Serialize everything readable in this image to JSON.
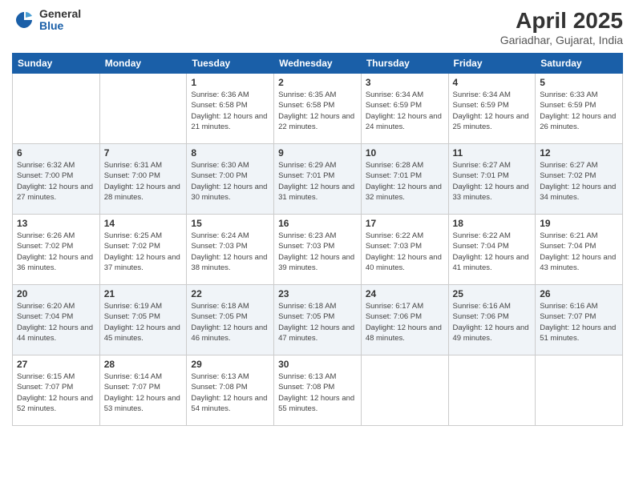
{
  "header": {
    "logo_general": "General",
    "logo_blue": "Blue",
    "month": "April 2025",
    "location": "Gariadhar, Gujarat, India"
  },
  "days_of_week": [
    "Sunday",
    "Monday",
    "Tuesday",
    "Wednesday",
    "Thursday",
    "Friday",
    "Saturday"
  ],
  "weeks": [
    [
      {
        "day": "",
        "sunrise": "",
        "sunset": "",
        "daylight": ""
      },
      {
        "day": "",
        "sunrise": "",
        "sunset": "",
        "daylight": ""
      },
      {
        "day": "1",
        "sunrise": "Sunrise: 6:36 AM",
        "sunset": "Sunset: 6:58 PM",
        "daylight": "Daylight: 12 hours and 21 minutes."
      },
      {
        "day": "2",
        "sunrise": "Sunrise: 6:35 AM",
        "sunset": "Sunset: 6:58 PM",
        "daylight": "Daylight: 12 hours and 22 minutes."
      },
      {
        "day": "3",
        "sunrise": "Sunrise: 6:34 AM",
        "sunset": "Sunset: 6:59 PM",
        "daylight": "Daylight: 12 hours and 24 minutes."
      },
      {
        "day": "4",
        "sunrise": "Sunrise: 6:34 AM",
        "sunset": "Sunset: 6:59 PM",
        "daylight": "Daylight: 12 hours and 25 minutes."
      },
      {
        "day": "5",
        "sunrise": "Sunrise: 6:33 AM",
        "sunset": "Sunset: 6:59 PM",
        "daylight": "Daylight: 12 hours and 26 minutes."
      }
    ],
    [
      {
        "day": "6",
        "sunrise": "Sunrise: 6:32 AM",
        "sunset": "Sunset: 7:00 PM",
        "daylight": "Daylight: 12 hours and 27 minutes."
      },
      {
        "day": "7",
        "sunrise": "Sunrise: 6:31 AM",
        "sunset": "Sunset: 7:00 PM",
        "daylight": "Daylight: 12 hours and 28 minutes."
      },
      {
        "day": "8",
        "sunrise": "Sunrise: 6:30 AM",
        "sunset": "Sunset: 7:00 PM",
        "daylight": "Daylight: 12 hours and 30 minutes."
      },
      {
        "day": "9",
        "sunrise": "Sunrise: 6:29 AM",
        "sunset": "Sunset: 7:01 PM",
        "daylight": "Daylight: 12 hours and 31 minutes."
      },
      {
        "day": "10",
        "sunrise": "Sunrise: 6:28 AM",
        "sunset": "Sunset: 7:01 PM",
        "daylight": "Daylight: 12 hours and 32 minutes."
      },
      {
        "day": "11",
        "sunrise": "Sunrise: 6:27 AM",
        "sunset": "Sunset: 7:01 PM",
        "daylight": "Daylight: 12 hours and 33 minutes."
      },
      {
        "day": "12",
        "sunrise": "Sunrise: 6:27 AM",
        "sunset": "Sunset: 7:02 PM",
        "daylight": "Daylight: 12 hours and 34 minutes."
      }
    ],
    [
      {
        "day": "13",
        "sunrise": "Sunrise: 6:26 AM",
        "sunset": "Sunset: 7:02 PM",
        "daylight": "Daylight: 12 hours and 36 minutes."
      },
      {
        "day": "14",
        "sunrise": "Sunrise: 6:25 AM",
        "sunset": "Sunset: 7:02 PM",
        "daylight": "Daylight: 12 hours and 37 minutes."
      },
      {
        "day": "15",
        "sunrise": "Sunrise: 6:24 AM",
        "sunset": "Sunset: 7:03 PM",
        "daylight": "Daylight: 12 hours and 38 minutes."
      },
      {
        "day": "16",
        "sunrise": "Sunrise: 6:23 AM",
        "sunset": "Sunset: 7:03 PM",
        "daylight": "Daylight: 12 hours and 39 minutes."
      },
      {
        "day": "17",
        "sunrise": "Sunrise: 6:22 AM",
        "sunset": "Sunset: 7:03 PM",
        "daylight": "Daylight: 12 hours and 40 minutes."
      },
      {
        "day": "18",
        "sunrise": "Sunrise: 6:22 AM",
        "sunset": "Sunset: 7:04 PM",
        "daylight": "Daylight: 12 hours and 41 minutes."
      },
      {
        "day": "19",
        "sunrise": "Sunrise: 6:21 AM",
        "sunset": "Sunset: 7:04 PM",
        "daylight": "Daylight: 12 hours and 43 minutes."
      }
    ],
    [
      {
        "day": "20",
        "sunrise": "Sunrise: 6:20 AM",
        "sunset": "Sunset: 7:04 PM",
        "daylight": "Daylight: 12 hours and 44 minutes."
      },
      {
        "day": "21",
        "sunrise": "Sunrise: 6:19 AM",
        "sunset": "Sunset: 7:05 PM",
        "daylight": "Daylight: 12 hours and 45 minutes."
      },
      {
        "day": "22",
        "sunrise": "Sunrise: 6:18 AM",
        "sunset": "Sunset: 7:05 PM",
        "daylight": "Daylight: 12 hours and 46 minutes."
      },
      {
        "day": "23",
        "sunrise": "Sunrise: 6:18 AM",
        "sunset": "Sunset: 7:05 PM",
        "daylight": "Daylight: 12 hours and 47 minutes."
      },
      {
        "day": "24",
        "sunrise": "Sunrise: 6:17 AM",
        "sunset": "Sunset: 7:06 PM",
        "daylight": "Daylight: 12 hours and 48 minutes."
      },
      {
        "day": "25",
        "sunrise": "Sunrise: 6:16 AM",
        "sunset": "Sunset: 7:06 PM",
        "daylight": "Daylight: 12 hours and 49 minutes."
      },
      {
        "day": "26",
        "sunrise": "Sunrise: 6:16 AM",
        "sunset": "Sunset: 7:07 PM",
        "daylight": "Daylight: 12 hours and 51 minutes."
      }
    ],
    [
      {
        "day": "27",
        "sunrise": "Sunrise: 6:15 AM",
        "sunset": "Sunset: 7:07 PM",
        "daylight": "Daylight: 12 hours and 52 minutes."
      },
      {
        "day": "28",
        "sunrise": "Sunrise: 6:14 AM",
        "sunset": "Sunset: 7:07 PM",
        "daylight": "Daylight: 12 hours and 53 minutes."
      },
      {
        "day": "29",
        "sunrise": "Sunrise: 6:13 AM",
        "sunset": "Sunset: 7:08 PM",
        "daylight": "Daylight: 12 hours and 54 minutes."
      },
      {
        "day": "30",
        "sunrise": "Sunrise: 6:13 AM",
        "sunset": "Sunset: 7:08 PM",
        "daylight": "Daylight: 12 hours and 55 minutes."
      },
      {
        "day": "",
        "sunrise": "",
        "sunset": "",
        "daylight": ""
      },
      {
        "day": "",
        "sunrise": "",
        "sunset": "",
        "daylight": ""
      },
      {
        "day": "",
        "sunrise": "",
        "sunset": "",
        "daylight": ""
      }
    ]
  ]
}
